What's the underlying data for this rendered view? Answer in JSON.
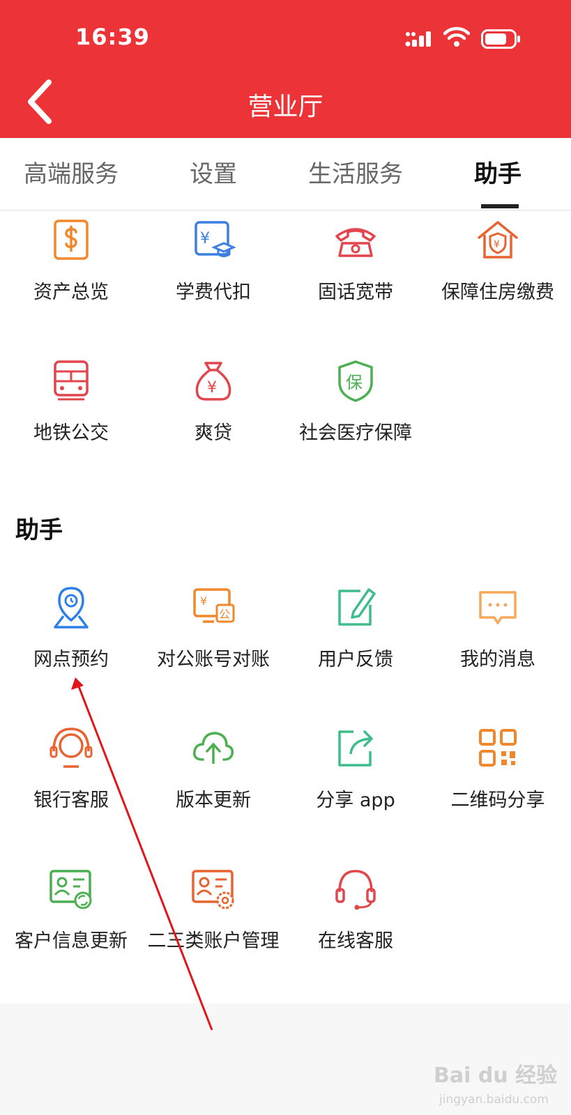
{
  "status_bar": {
    "time": "16:39"
  },
  "header": {
    "title": "营业厅",
    "back_icon": "chevron-left-icon",
    "bg_color": "#ec3338"
  },
  "tabs": [
    {
      "label": "高端服务",
      "active": false
    },
    {
      "label": "设置",
      "active": false
    },
    {
      "label": "生活服务",
      "active": false
    },
    {
      "label": "助手",
      "active": true
    }
  ],
  "life_services": {
    "items": [
      {
        "label": "资产总览",
        "icon": "dollar-icon"
      },
      {
        "label": "学费代扣",
        "icon": "tuition-icon"
      },
      {
        "label": "固话宽带",
        "icon": "telephone-icon"
      },
      {
        "label": "保障住房缴费",
        "icon": "housing-icon"
      },
      {
        "label": "地铁公交",
        "icon": "metro-icon"
      },
      {
        "label": "爽贷",
        "icon": "money-bag-icon"
      },
      {
        "label": "社会医疗保障",
        "icon": "insurance-shield-icon"
      }
    ]
  },
  "assistant": {
    "title": "助手",
    "items": [
      {
        "label": "网点预约",
        "icon": "location-clock-icon"
      },
      {
        "label": "对公账号对账",
        "icon": "corporate-account-icon"
      },
      {
        "label": "用户反馈",
        "icon": "edit-feedback-icon"
      },
      {
        "label": "我的消息",
        "icon": "message-icon"
      },
      {
        "label": "银行客服",
        "icon": "service-agent-icon"
      },
      {
        "label": "版本更新",
        "icon": "cloud-upload-icon"
      },
      {
        "label": "分享 app",
        "icon": "share-icon"
      },
      {
        "label": "二维码分享",
        "icon": "qrcode-icon"
      },
      {
        "label": "客户信息更新",
        "icon": "id-card-refresh-icon"
      },
      {
        "label": "二三类账户管理",
        "icon": "id-card-gear-icon"
      },
      {
        "label": "在线客服",
        "icon": "headset-icon"
      }
    ]
  },
  "watermark": {
    "text": "Bai du 经验",
    "sub": "jingyan.baidu.com"
  }
}
